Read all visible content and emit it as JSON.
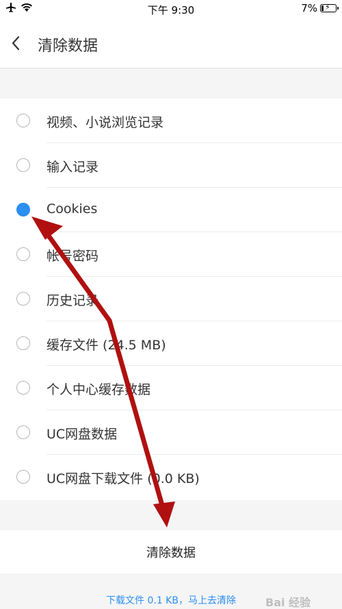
{
  "status_bar": {
    "time": "下午 9:30",
    "battery_text": "7%",
    "airplane_icon": "airplane-icon",
    "wifi_icon": "wifi-icon"
  },
  "nav": {
    "title": "清除数据",
    "back_icon": "chevron-left-icon"
  },
  "options": [
    {
      "label": "视频、小说浏览记录",
      "checked": false
    },
    {
      "label": "输入记录",
      "checked": false
    },
    {
      "label": "Cookies",
      "checked": true
    },
    {
      "label": "帐号密码",
      "checked": false
    },
    {
      "label": "历史记录",
      "checked": false
    },
    {
      "label": "缓存文件 (24.5 MB)",
      "checked": false
    },
    {
      "label": "个人中心缓存数据",
      "checked": false
    },
    {
      "label": "UC网盘数据",
      "checked": false
    },
    {
      "label": "UC网盘下载文件 (0.0 KB)",
      "checked": false
    }
  ],
  "clear_button": {
    "label": "清除数据"
  },
  "footer": {
    "link_text": "下载文件 0.1 KB，马上去清除"
  },
  "watermark": {
    "text": "Bai 经验"
  },
  "colors": {
    "accent": "#2a8ef2",
    "annotation_arrow": "#b01010"
  }
}
